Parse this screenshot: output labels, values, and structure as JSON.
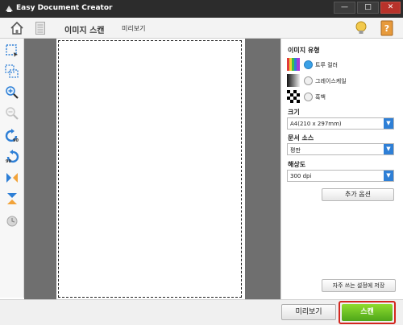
{
  "window": {
    "title": "Easy Document Creator",
    "controls": {
      "minimize": "—",
      "maximize": "□",
      "close": "✕"
    }
  },
  "toolbar": {
    "tab_scan": "이미지 스캔",
    "tab_preview": "미리보기"
  },
  "panel": {
    "image_type": {
      "label": "이미지 유형",
      "options": [
        {
          "label": "트루 컬러",
          "selected": true
        },
        {
          "label": "그레이스케일",
          "selected": false
        },
        {
          "label": "흑백",
          "selected": false
        }
      ]
    },
    "size": {
      "label": "크기",
      "value": "A4(210 x 297mm)"
    },
    "source": {
      "label": "문서 소스",
      "value": "평판"
    },
    "resolution": {
      "label": "해상도",
      "value": "300 dpi"
    },
    "more_options": "추가 옵션",
    "save_favorite": "자주 쓰는 설정에 저장"
  },
  "bottom": {
    "preview_button": "미리보기",
    "scan_button": "스캔"
  },
  "colors": {
    "titlebar": "#2c2c2c",
    "accent_blue": "#2e7fd6",
    "scan_green": "#4ea61a",
    "highlight_red": "#d3271e",
    "preview_bg": "#6f6f6f"
  },
  "icons": {
    "left_tools": [
      "select-area-icon",
      "multi-select-icon",
      "zoom-in-icon",
      "zoom-out-icon",
      "rotate-left-90-icon",
      "rotate-right-90-icon",
      "flip-horizontal-icon",
      "flip-vertical-icon",
      "reset-icon"
    ]
  }
}
